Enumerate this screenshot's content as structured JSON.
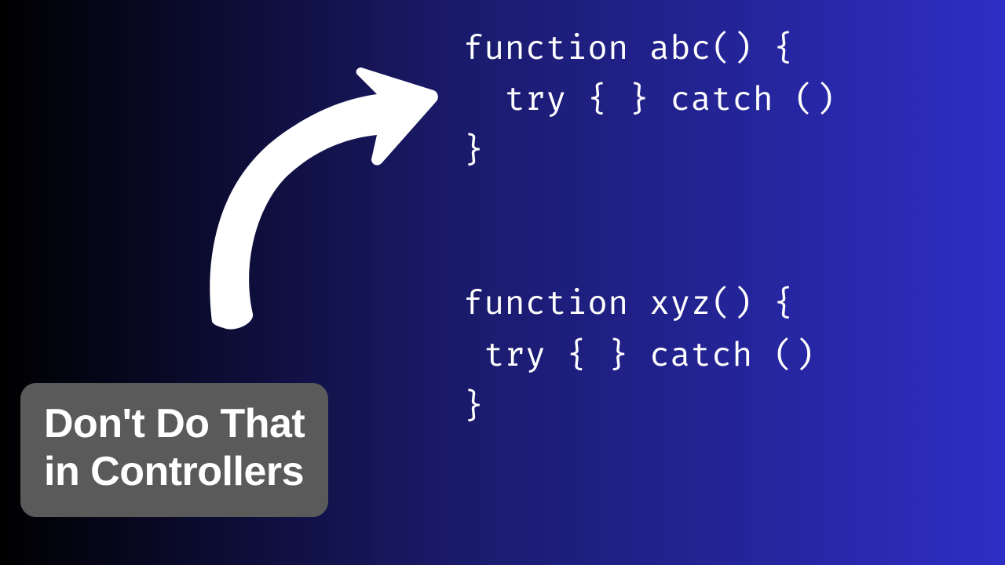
{
  "code": {
    "lines": [
      "function abc() {",
      "  try { } catch ()",
      "}",
      "",
      "",
      "function xyz() {",
      " try { } catch ()",
      "}"
    ]
  },
  "caption": {
    "line1": "Don't Do That",
    "line2": "in Controllers"
  },
  "arrow": {
    "semantic": "curved-arrow-pointing-up-right",
    "color": "#ffffff"
  },
  "colors": {
    "background_gradient_start": "#000000",
    "background_gradient_end": "#2e2ec5",
    "caption_bg": "#5a5a5a",
    "text": "#ffffff"
  }
}
